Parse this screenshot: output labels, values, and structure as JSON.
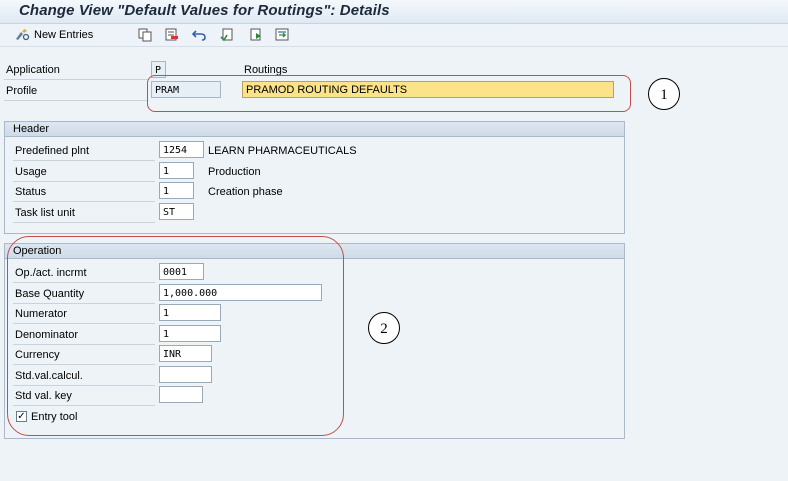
{
  "window": {
    "title": "Change View \"Default Values for Routings\": Details"
  },
  "toolbar": {
    "new_entries_label": "New Entries",
    "icons": [
      "display-change-icon",
      "copy-icon",
      "delete-icon",
      "undo-icon",
      "select-all-icon",
      "prev-entry-icon",
      "next-entry-icon"
    ]
  },
  "top_fields": {
    "application": {
      "label": "Application",
      "value": "P",
      "text": "Routings"
    },
    "profile": {
      "label": "Profile",
      "value": "PRAM",
      "text": "PRAMOD ROUTING DEFAULTS"
    }
  },
  "header": {
    "title": "Header",
    "rows": [
      {
        "label": "Predefined plnt",
        "value": "1254",
        "text": "LEARN PHARMACEUTICALS"
      },
      {
        "label": "Usage",
        "value": "1",
        "text": "Production"
      },
      {
        "label": "Status",
        "value": "1",
        "text": "Creation phase"
      },
      {
        "label": "Task list unit",
        "value": "ST",
        "text": ""
      }
    ]
  },
  "operation": {
    "title": "Operation",
    "rows": [
      {
        "label": "Op./act. incrmt",
        "value": "0001"
      },
      {
        "label": "Base Quantity",
        "value": "1,000.000"
      },
      {
        "label": "Numerator",
        "value": "1"
      },
      {
        "label": "Denominator",
        "value": "1"
      },
      {
        "label": "Currency",
        "value": "INR"
      },
      {
        "label": "Std.val.calcul.",
        "value": ""
      },
      {
        "label": "Std val. key",
        "value": ""
      }
    ],
    "entry_tool": {
      "label": "Entry tool",
      "checked": true,
      "mark": "✓"
    }
  },
  "annotations": {
    "one": "1",
    "two": "2"
  },
  "colors": {
    "highlight_frame": "#c0504d",
    "profile_text_bg": "#fbe38a"
  }
}
